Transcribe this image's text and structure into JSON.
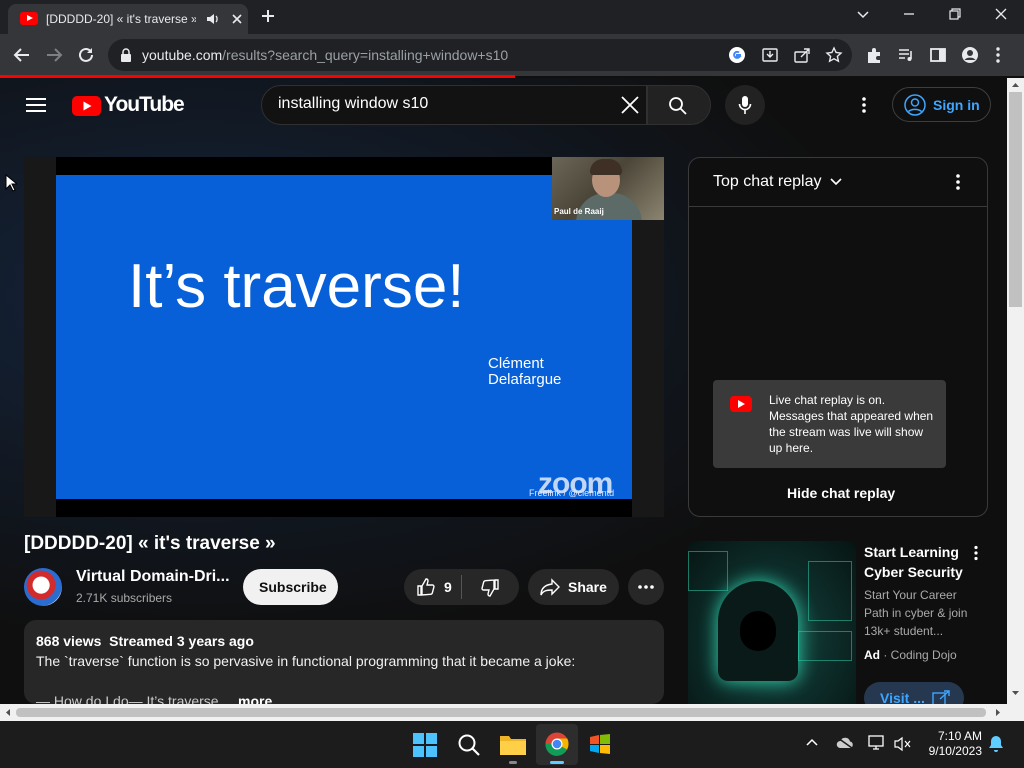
{
  "browser": {
    "tab_title": "[DDDDD-20] « it's traverse »",
    "url_host": "youtube.com",
    "url_path": "/results?search_query=installing+window+s10"
  },
  "youtube": {
    "logo_text": "YouTube",
    "search_value": "installing window s10",
    "signin_label": "Sign in"
  },
  "video": {
    "slide_title": "It’s traverse!",
    "slide_author_line1": "Clément",
    "slide_author_line2": "Delafargue",
    "zoom_logo": "zoom",
    "freelink": "Freelink / @clementd",
    "webcam_name": "Paul de Raaij",
    "title": "[DDDDD-20] « it's traverse »",
    "channel_name": "Virtual Domain-Dri...",
    "subscribers": "2.71K subscribers",
    "subscribe_label": "Subscribe",
    "like_count": "9",
    "share_label": "Share",
    "description": {
      "meta": "868 views  Streamed 3 years ago",
      "text": "The `traverse` function is so pervasive in functional programming that it became a joke:",
      "snippet": "— How do I do— It’s traverse",
      "more_label": "more"
    }
  },
  "chat": {
    "title": "Top chat replay",
    "notice": "Live chat replay is on. Messages that appeared when the stream was live will show up here.",
    "hide_label": "Hide chat replay"
  },
  "ad": {
    "title": "Start Learning Cyber Security",
    "description": "Start Your Career Path in cyber & join 13k+ student...",
    "ad_label": "Ad",
    "sponsor": "Coding Dojo",
    "visit_label": "Visit ..."
  },
  "taskbar": {
    "time": "7:10 AM",
    "date": "9/10/2023"
  },
  "colors": {
    "youtube_red": "#ff0000",
    "link_blue": "#3ea6ff",
    "slide_blue": "#0860d8"
  },
  "icons": [
    "youtube-favicon",
    "speaker-icon",
    "close-icon",
    "plus-icon",
    "back-icon",
    "forward-icon",
    "reload-icon",
    "lock-icon",
    "google-icon",
    "install-icon",
    "share-icon",
    "star-icon",
    "extensions-icon",
    "media-icon",
    "sidepanel-icon",
    "profile-icon",
    "kebab-icon",
    "hamburger-icon",
    "search-icon",
    "mic-icon",
    "account-icon",
    "thumbs-up-icon",
    "thumbs-down-icon",
    "share-arrow-icon",
    "more-icon",
    "chevron-down-icon",
    "windows-start-icon",
    "taskbar-search-icon",
    "file-explorer-icon",
    "chrome-icon",
    "windows-flag-icon",
    "notification-bell-icon"
  ]
}
